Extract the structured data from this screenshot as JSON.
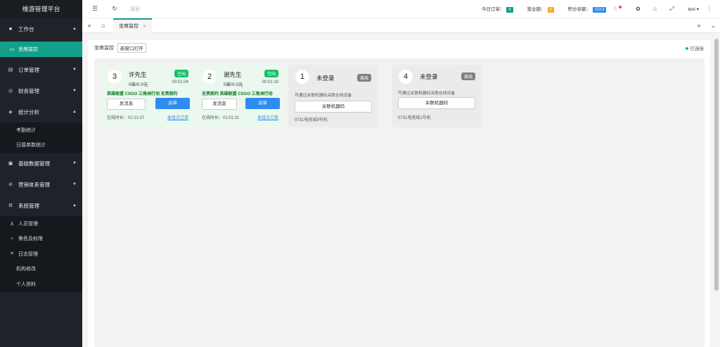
{
  "app": {
    "title": "维游管理平台"
  },
  "sidebar": {
    "groups": [
      {
        "label": "工作台",
        "icon": "dashboard-icon",
        "arrow": "▲"
      },
      {
        "label": "订单管理",
        "icon": "order-icon",
        "arrow": "▼"
      },
      {
        "label": "财务管理",
        "icon": "finance-icon",
        "arrow": "▼"
      },
      {
        "label": "统计分析",
        "icon": "stats-icon",
        "arrow": "▲"
      },
      {
        "label": "基础数据管理",
        "icon": "data-icon",
        "arrow": "▼"
      },
      {
        "label": "营销体系管理",
        "icon": "marketing-icon",
        "arrow": "▼"
      },
      {
        "label": "系统管理",
        "icon": "system-icon",
        "arrow": "▲"
      }
    ],
    "workbench_items": [
      {
        "label": "坐席监控"
      }
    ],
    "stats_items": [
      {
        "label": "考勤统计"
      },
      {
        "label": "日接单数统计"
      }
    ],
    "system_items": [
      {
        "label": "人员管理"
      },
      {
        "label": "角色及权限"
      },
      {
        "label": "日志管理"
      },
      {
        "label": "机构修改"
      },
      {
        "label": "个人资料"
      }
    ]
  },
  "header": {
    "search_placeholder": "搜索",
    "today_orders_label": "今日订单：",
    "today_orders": "0",
    "revenue_label": "营业额：",
    "revenue": "0",
    "points_label": "积分余额：",
    "points": "113.3",
    "user": "test ▾"
  },
  "tabs": [
    {
      "label": "坐席监控"
    }
  ],
  "page": {
    "title": "坐席监控",
    "new_window": "新窗口打开",
    "status": "已连接"
  },
  "seats": [
    {
      "num": "3",
      "name": "许先生",
      "tag": "空闲",
      "stat": "0单/0.0元",
      "timer": "00:01:04",
      "games": "英雄联盟 CSGO 三角洲行动 无畏契约",
      "msg_btn": "发消息",
      "order_btn": "派单",
      "online": "在线时长：02:21:07",
      "link": "本班次订单"
    },
    {
      "num": "2",
      "name": "谢先生",
      "tag": "空闲",
      "stat": "0单/0.0元",
      "timer": "00:01:19",
      "games": "无畏契约 英雄联盟 CSGO 三角洲行动",
      "msg_btn": "发消息",
      "order_btn": "派单",
      "online": "在线时长：01:01:31",
      "link": "本班次订单"
    },
    {
      "num": "1",
      "name": "未登录",
      "tag": "离线",
      "tip": "可通过关联机器码关联在线设备",
      "bind_btn": "关联机器码",
      "tail": "0731电竞城9号机"
    },
    {
      "num": "4",
      "name": "未登录",
      "tag": "离线",
      "tip": "可通过关联机器码关联在线设备",
      "bind_btn": "关联机器码",
      "tail": "0731电竞城1号机"
    }
  ],
  "colors": {
    "accent": "#13a08b",
    "blue": "#2d8cf0",
    "sidebar": "#1f2329"
  }
}
